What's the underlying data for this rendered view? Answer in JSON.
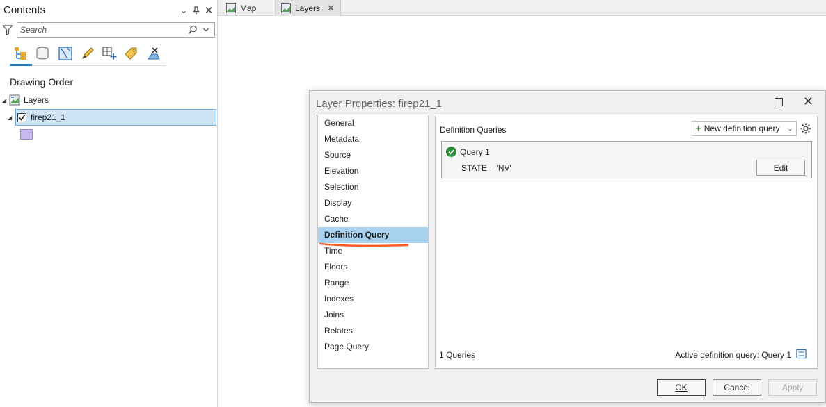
{
  "contents": {
    "title": "Contents",
    "search_placeholder": "Search",
    "section_title": "Drawing Order",
    "tree": {
      "map_label": "Layers",
      "layer_label": "firep21_1",
      "layer_checked": true
    },
    "toolbar_icons": [
      "list-by-drawing-order-icon",
      "list-by-data-source-icon",
      "list-by-selection-icon",
      "list-by-editing-icon",
      "list-by-snapping-icon",
      "list-by-labeling-icon",
      "list-by-perspective-icon"
    ]
  },
  "tabs": [
    {
      "label": "Map",
      "active": false
    },
    {
      "label": "Layers",
      "active": true
    }
  ],
  "dialog": {
    "title": "Layer Properties: firep21_1",
    "nav_items": [
      "General",
      "Metadata",
      "Source",
      "Elevation",
      "Selection",
      "Display",
      "Cache",
      "Definition Query",
      "Time",
      "Floors",
      "Range",
      "Indexes",
      "Joins",
      "Relates",
      "Page Query"
    ],
    "selected_nav": "Definition Query",
    "panel": {
      "heading": "Definition Queries",
      "new_button": "New definition query",
      "query": {
        "name": "Query 1",
        "expression": "STATE = 'NV'",
        "edit_label": "Edit"
      },
      "count_text": "1 Queries",
      "active_text": "Active definition query: Query 1"
    },
    "buttons": {
      "ok": "OK",
      "cancel": "Cancel",
      "apply": "Apply"
    }
  },
  "colors": {
    "accent": "#1c7ec8",
    "selection": "#a9d2f0",
    "annotation": "#ff5a1f",
    "symbol_fill": "#c9b8ee",
    "check_green": "#2e8b3a"
  }
}
